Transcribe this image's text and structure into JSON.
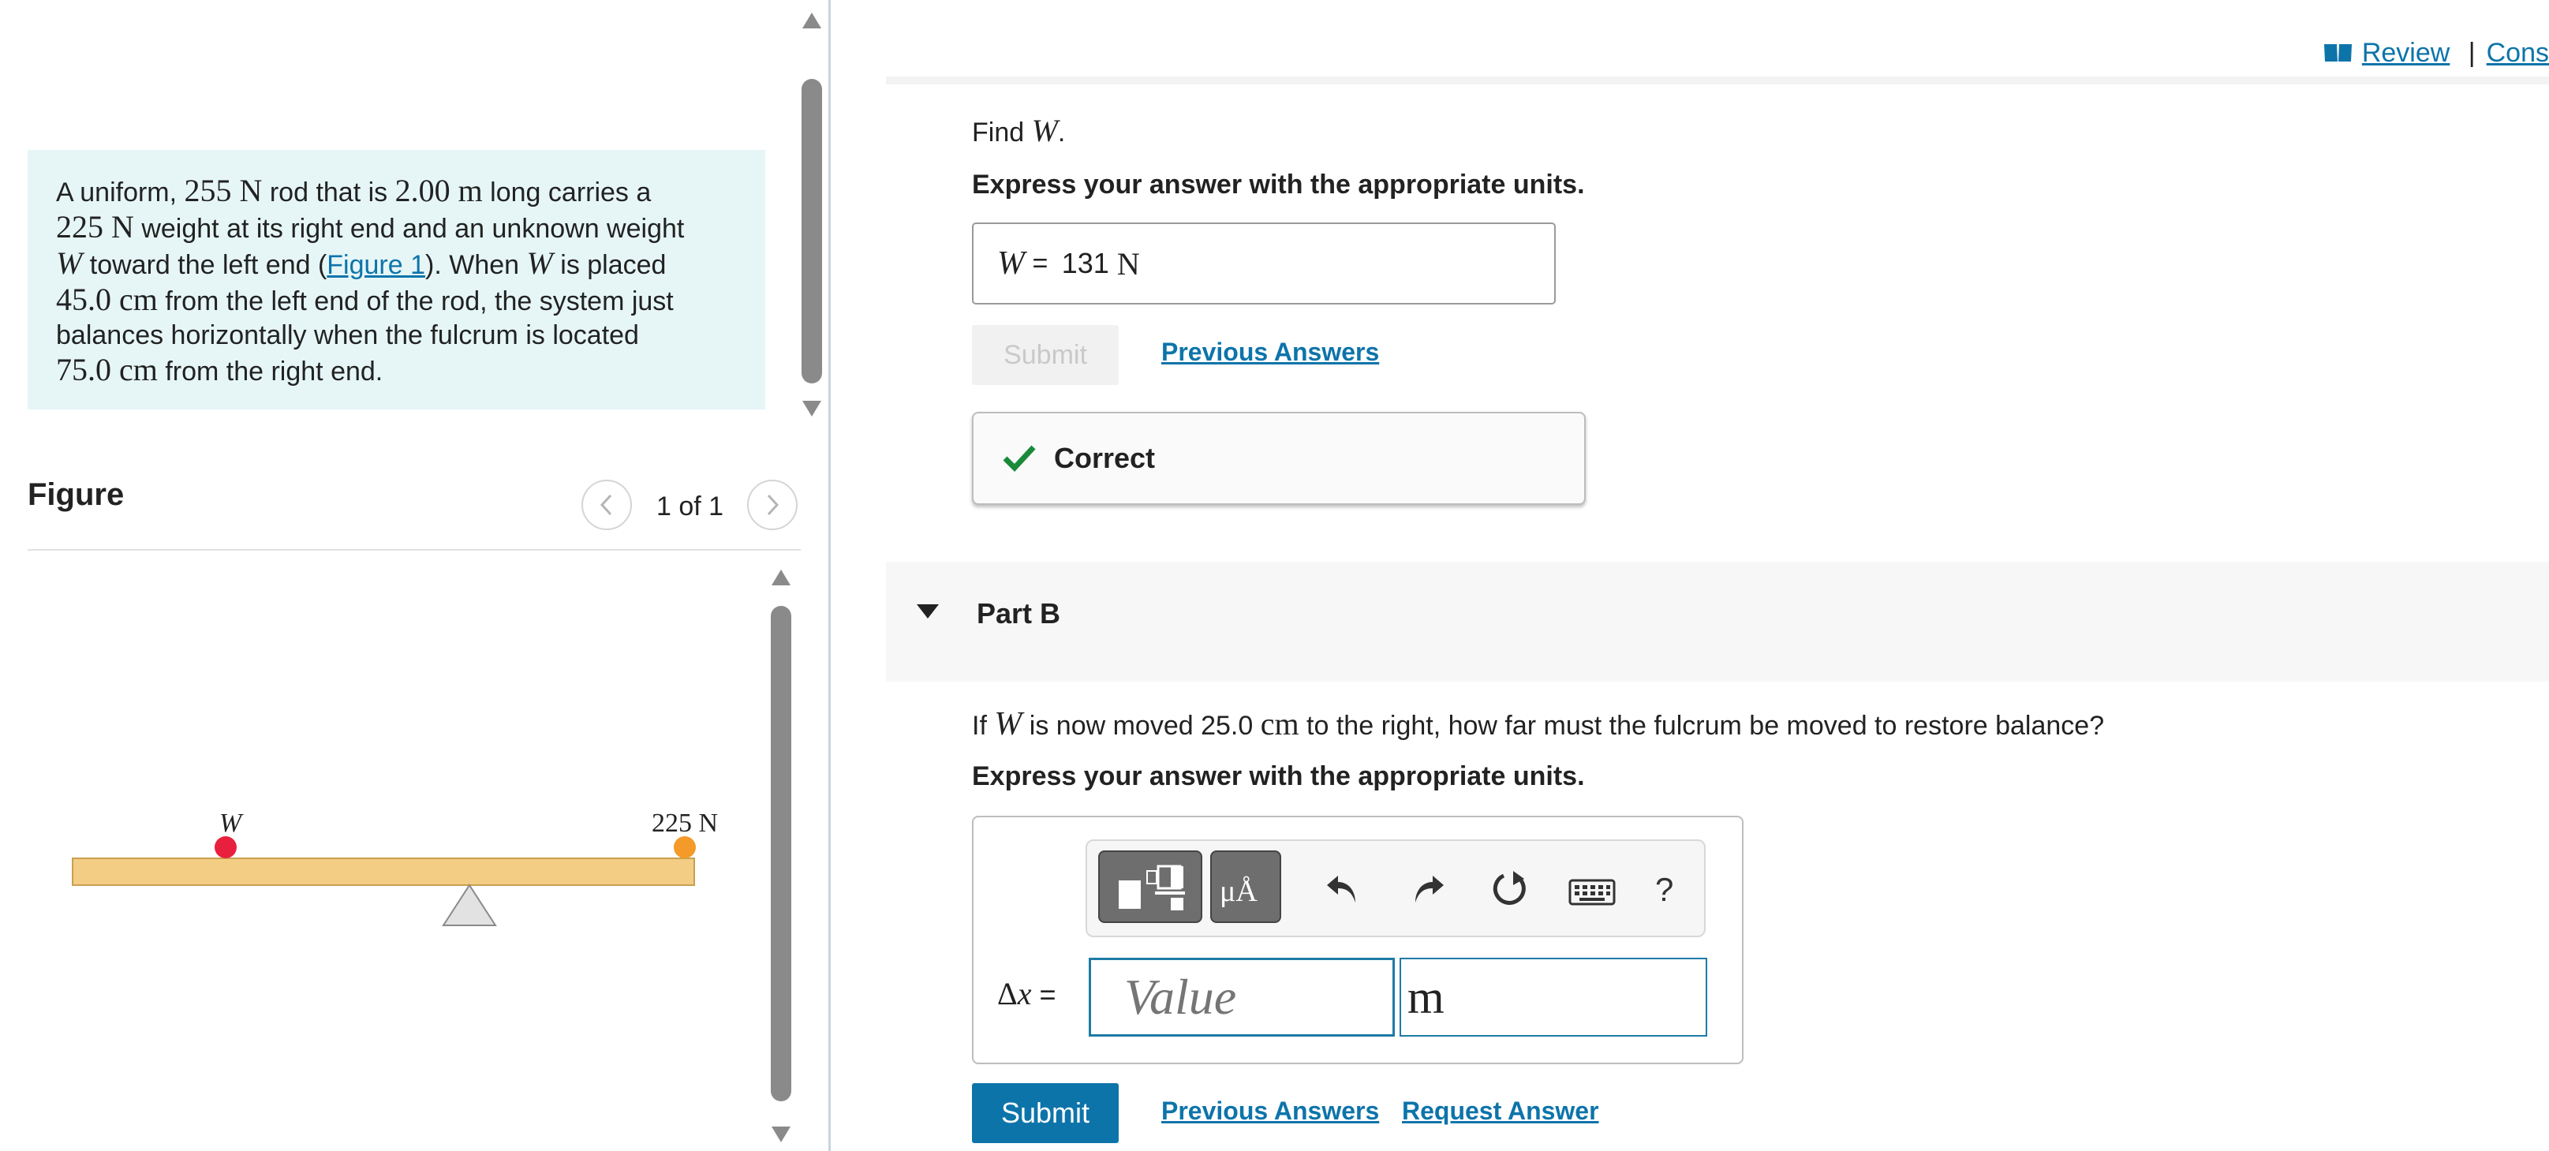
{
  "problem": {
    "t1": "A uniform, ",
    "m1": "255 N",
    "t2": " rod that is ",
    "m2": "2.00 m",
    "t3": " long carries a",
    "m3": "225 N",
    "t4": " weight at its right end and an unknown weight",
    "m4": "W",
    "t5": " toward the left end (",
    "link": "Figure 1",
    "t6": "). When ",
    "m5": "W",
    "t7": " is placed",
    "m6": "45.0 cm",
    "t8": " from the left end of the rod, the system just",
    "t9": "balances horizontally when the fulcrum is located",
    "m7": "75.0 cm",
    "t10": " from the right end."
  },
  "figure": {
    "title": "Figure",
    "counter": "1 of 1",
    "label_w": "W",
    "label_weight": "225 N",
    "colors": {
      "rod": "#f3cd83",
      "rod_border": "#c9a050",
      "left_ball": "#e8203e",
      "right_ball": "#f39a28",
      "fulcrum": "#e2e2e2"
    }
  },
  "top_links": {
    "review": "Review",
    "separator": "|",
    "constants": "Cons"
  },
  "part_a": {
    "find_prefix": "Find ",
    "find_var": "W",
    "find_suffix": ".",
    "instruction": "Express your answer with the appropriate units.",
    "answer_var": "W",
    "answer_eq": " = ",
    "answer_value": "131",
    "answer_unit": "N",
    "submit": "Submit",
    "previous_answers": "Previous Answers",
    "feedback": "Correct"
  },
  "part_b": {
    "title": "Part B",
    "q_prefix": "If ",
    "q_var": "W",
    "q_mid": " is now moved 25.0 ",
    "q_unit": "cm",
    "q_suffix": " to the right, how far must the fulcrum be moved to restore balance?",
    "instruction": "Express your answer with the appropriate units.",
    "label_delta": "Δ",
    "label_var": "x",
    "label_eq": " =",
    "value_placeholder": "Value",
    "unit_value": "m",
    "tool_units": "μÅ",
    "tool_help": "?",
    "submit": "Submit",
    "previous_answers": "Previous Answers",
    "request_answer": "Request Answer"
  }
}
